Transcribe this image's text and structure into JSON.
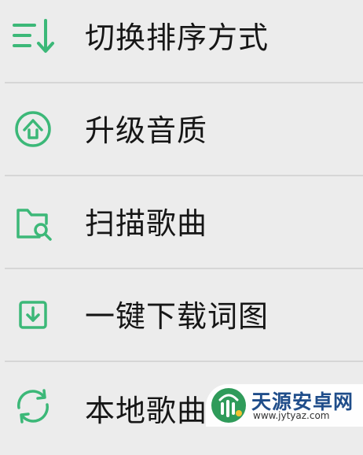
{
  "menu": {
    "accent_color": "#3cb878",
    "items": [
      {
        "label": "切换排序方式",
        "icon": "sort-icon"
      },
      {
        "label": "升级音质",
        "icon": "upgrade-quality-icon"
      },
      {
        "label": "扫描歌曲",
        "icon": "scan-folder-icon"
      },
      {
        "label": "一键下载词图",
        "icon": "download-icon"
      },
      {
        "label": "本地歌曲",
        "icon": "sync-icon"
      }
    ]
  },
  "watermark": {
    "title": "天源安卓网",
    "url": "www.jytyaz.com"
  }
}
